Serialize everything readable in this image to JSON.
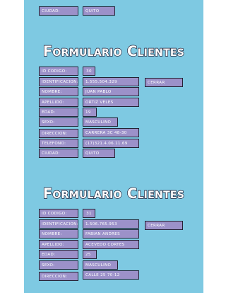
{
  "top_partial": {
    "ciudad_label": "Ciudad:",
    "ciudad_value": "Quito"
  },
  "form1": {
    "title": "Formulario Clientes",
    "codigo_label": "ID codigo:",
    "codigo_value": "30",
    "identificacion_label": "Identificacion:",
    "identificacion_value": "1.555.504.329",
    "cerrar_label": "Cerrar",
    "nombre_label": "Nombre:",
    "nombre_value": "Juan Pablo",
    "apellido_label": "Apellido:",
    "apellido_value": "Ortiz Veles",
    "edad_label": "Edad:",
    "edad_value": "19",
    "sexo_label": "Sexo:",
    "sexo_value": "Masculino",
    "direccion_label": "Direccion:",
    "direccion_value": "Carrera 3C 48-30",
    "telefono_label": "Telefono:",
    "telefono_value": "(17)321.4.06.11.69",
    "ciudad_label": "Ciudad:",
    "ciudad_value": "Quito"
  },
  "form2": {
    "title": "Formulario Clientes",
    "codigo_label": "ID codigo:",
    "codigo_value": "31",
    "identificacion_label": "Identificacion:",
    "identificacion_value": "1.506.765.953",
    "cerrar_label": "Cerrar",
    "nombre_label": "Nombre:",
    "nombre_value": "Fabian Andres",
    "apellido_label": "Apellido:",
    "apellido_value": "Acevedo Cortes",
    "edad_label": "Edad:",
    "edad_value": "25",
    "sexo_label": "Sexo:",
    "sexo_value": "Masculino",
    "direccion_label": "Direccion:",
    "direccion_value": "Calle 25 70-12"
  },
  "colors": {
    "panel_background": "#7ec9e2",
    "field_background": "#9c91c9",
    "field_border": "#222233",
    "text": "#ffffff"
  }
}
